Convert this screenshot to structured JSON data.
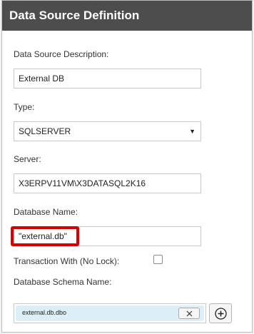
{
  "header": {
    "title": "Data Source Definition"
  },
  "form": {
    "description": {
      "label": "Data Source Description:",
      "value": "External DB"
    },
    "type": {
      "label": "Type:",
      "value": "SQLSERVER",
      "arrow": "▼"
    },
    "server": {
      "label": "Server:",
      "value": "X3ERPV11VM\\X3DATASQL2K16"
    },
    "database": {
      "label": "Database Name:",
      "value": "\"external.db\"",
      "highlight_color": "#d50000"
    },
    "transaction": {
      "label": "Transaction With (No Lock):",
      "checked": false
    },
    "schema": {
      "label": "Database Schema Name:",
      "tags": [
        "external.db.dbo"
      ]
    }
  },
  "icons": {
    "remove": "close-icon",
    "add": "plus-circle-icon"
  },
  "colors": {
    "header_bg": "#4d4d4d",
    "tag_bg": "#dceef6"
  }
}
